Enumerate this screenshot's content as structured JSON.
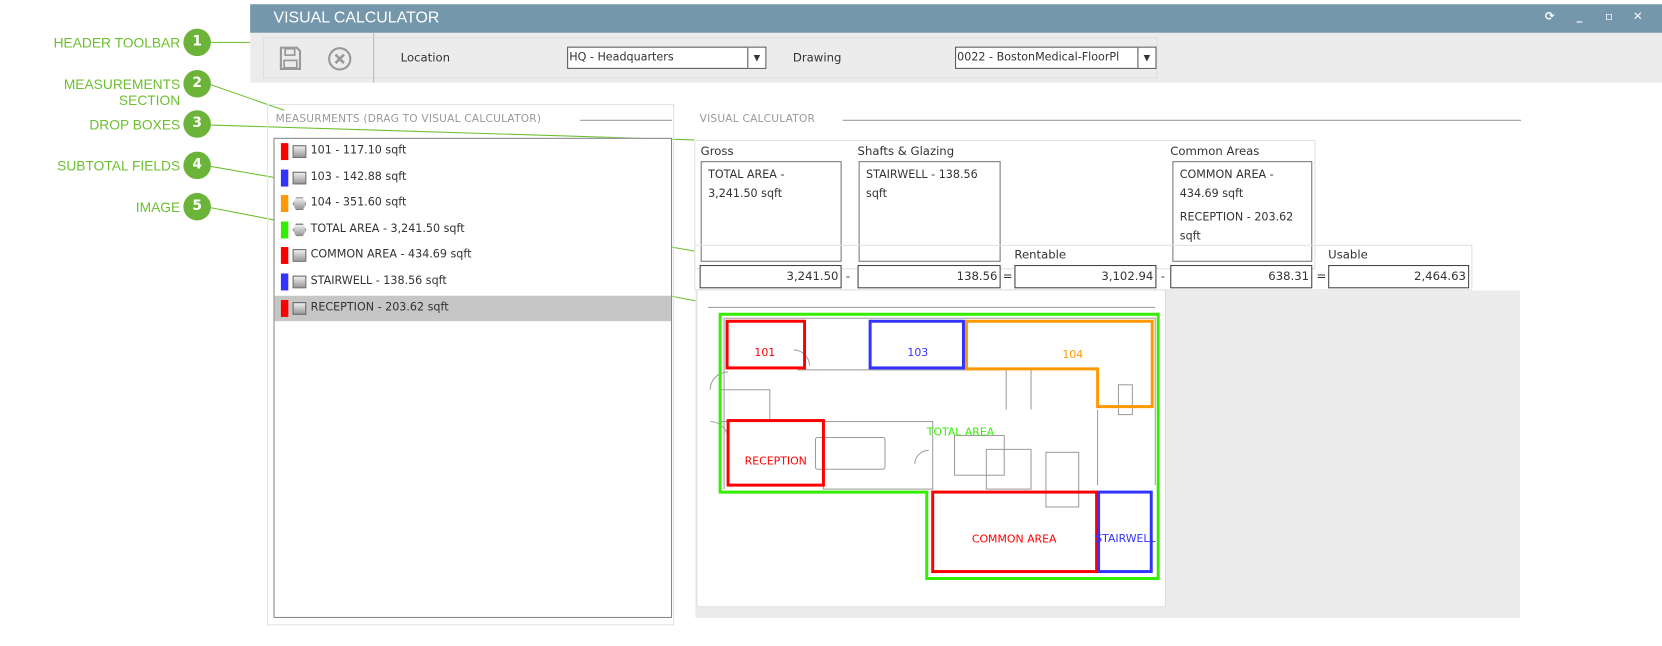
{
  "window": {
    "title": "VISUAL CALCULATOR",
    "controls": [
      "refresh-icon",
      "minimize-icon",
      "maximize-icon",
      "close-icon"
    ],
    "title_bg": "#7497ab"
  },
  "toolbar": {
    "location_label": "Location",
    "location_value": "HQ - Headquarters",
    "drawing_label": "Drawing",
    "drawing_value": "0022 - BostonMedical-FloorPl"
  },
  "annotations": [
    {
      "num": "1",
      "label": "HEADER TOOLBAR"
    },
    {
      "num": "2",
      "label": "MEASUREMENTS SECTION"
    },
    {
      "num": "3",
      "label": "DROP BOXES"
    },
    {
      "num": "4",
      "label": "SUBTOTAL FIELDS"
    },
    {
      "num": "5",
      "label": "IMAGE"
    }
  ],
  "measurements": {
    "header": "MEASURMENTS (DRAG TO VISUAL CALCULATOR)",
    "items": [
      {
        "label": "101 - 117.10 sqft",
        "color": "#ff0000",
        "shape": "rect"
      },
      {
        "label": "103 - 142.88 sqft",
        "color": "#3333ff",
        "shape": "rect"
      },
      {
        "label": "104 - 351.60 sqft",
        "color": "#ff9900",
        "shape": "hex"
      },
      {
        "label": "TOTAL AREA - 3,241.50 sqft",
        "color": "#33ee00",
        "shape": "hex"
      },
      {
        "label": "COMMON AREA - 434.69 sqft",
        "color": "#ff0000",
        "shape": "rect"
      },
      {
        "label": "STAIRWELL - 138.56 sqft",
        "color": "#3333ff",
        "shape": "rect"
      },
      {
        "label": "RECEPTION - 203.62 sqft",
        "color": "#ff0000",
        "shape": "rect",
        "selected": true
      }
    ]
  },
  "calculator": {
    "header": "VISUAL CALCULATOR",
    "gross": {
      "label": "Gross",
      "items": [
        "TOTAL AREA - 3,241.50 sqft"
      ]
    },
    "shafts": {
      "label": "Shafts & Glazing",
      "items": [
        "STAIRWELL - 138.56 sqft"
      ]
    },
    "common": {
      "label": "Common Areas",
      "items": [
        "COMMON AREA - 434.69 sqft",
        "RECEPTION - 203.62 sqft"
      ]
    },
    "rentable_label": "Rentable",
    "usable_label": "Usable",
    "subtotals": {
      "gross": "3,241.50",
      "shafts": "138.56",
      "rentable": "3,102.94",
      "common": "638.31",
      "usable": "2,464.63"
    },
    "ops": {
      "minus": "-",
      "equals": "="
    }
  },
  "floorplan": {
    "labels": {
      "r101": "101",
      "r103": "103",
      "r104": "104",
      "total": "TOTAL AREA",
      "reception": "RECEPTION",
      "common": "COMMON AREA",
      "stairwell": "STAIRWELL"
    },
    "colors": {
      "red": "#ff0000",
      "blue": "#3333ff",
      "orange": "#ff9900",
      "green": "#33ee00"
    }
  }
}
